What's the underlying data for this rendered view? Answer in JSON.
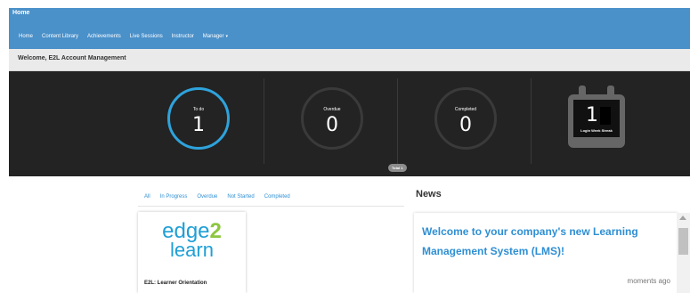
{
  "header": {
    "brand": "Home",
    "nav": [
      {
        "label": "Home"
      },
      {
        "label": "Content Library"
      },
      {
        "label": "Achievements"
      },
      {
        "label": "Live Sessions"
      },
      {
        "label": "Instructor"
      },
      {
        "label": "Manager",
        "caret": "▾"
      }
    ]
  },
  "welcome": {
    "text": "Welcome, E2L Account Management"
  },
  "dashboard": {
    "todo": {
      "label": "To do",
      "value": "1"
    },
    "overdue": {
      "label": "Overdue",
      "value": "0"
    },
    "completed": {
      "label": "Completed",
      "value": "0"
    },
    "streak": {
      "label": "Login Week Streak",
      "value": "1"
    },
    "total_badge": "Total 1",
    "accent_color": "#2ea3dc"
  },
  "tabs": [
    "All",
    "In Progress",
    "Overdue",
    "Not Started",
    "Completed"
  ],
  "course": {
    "logo": {
      "edge": "edge",
      "two": "2",
      "learn": "learn"
    },
    "title": "E2L: Learner Orientation"
  },
  "news": {
    "heading": "News",
    "title": "Welcome to your company's new Learning Management System (LMS)!",
    "time": "moments ago"
  }
}
